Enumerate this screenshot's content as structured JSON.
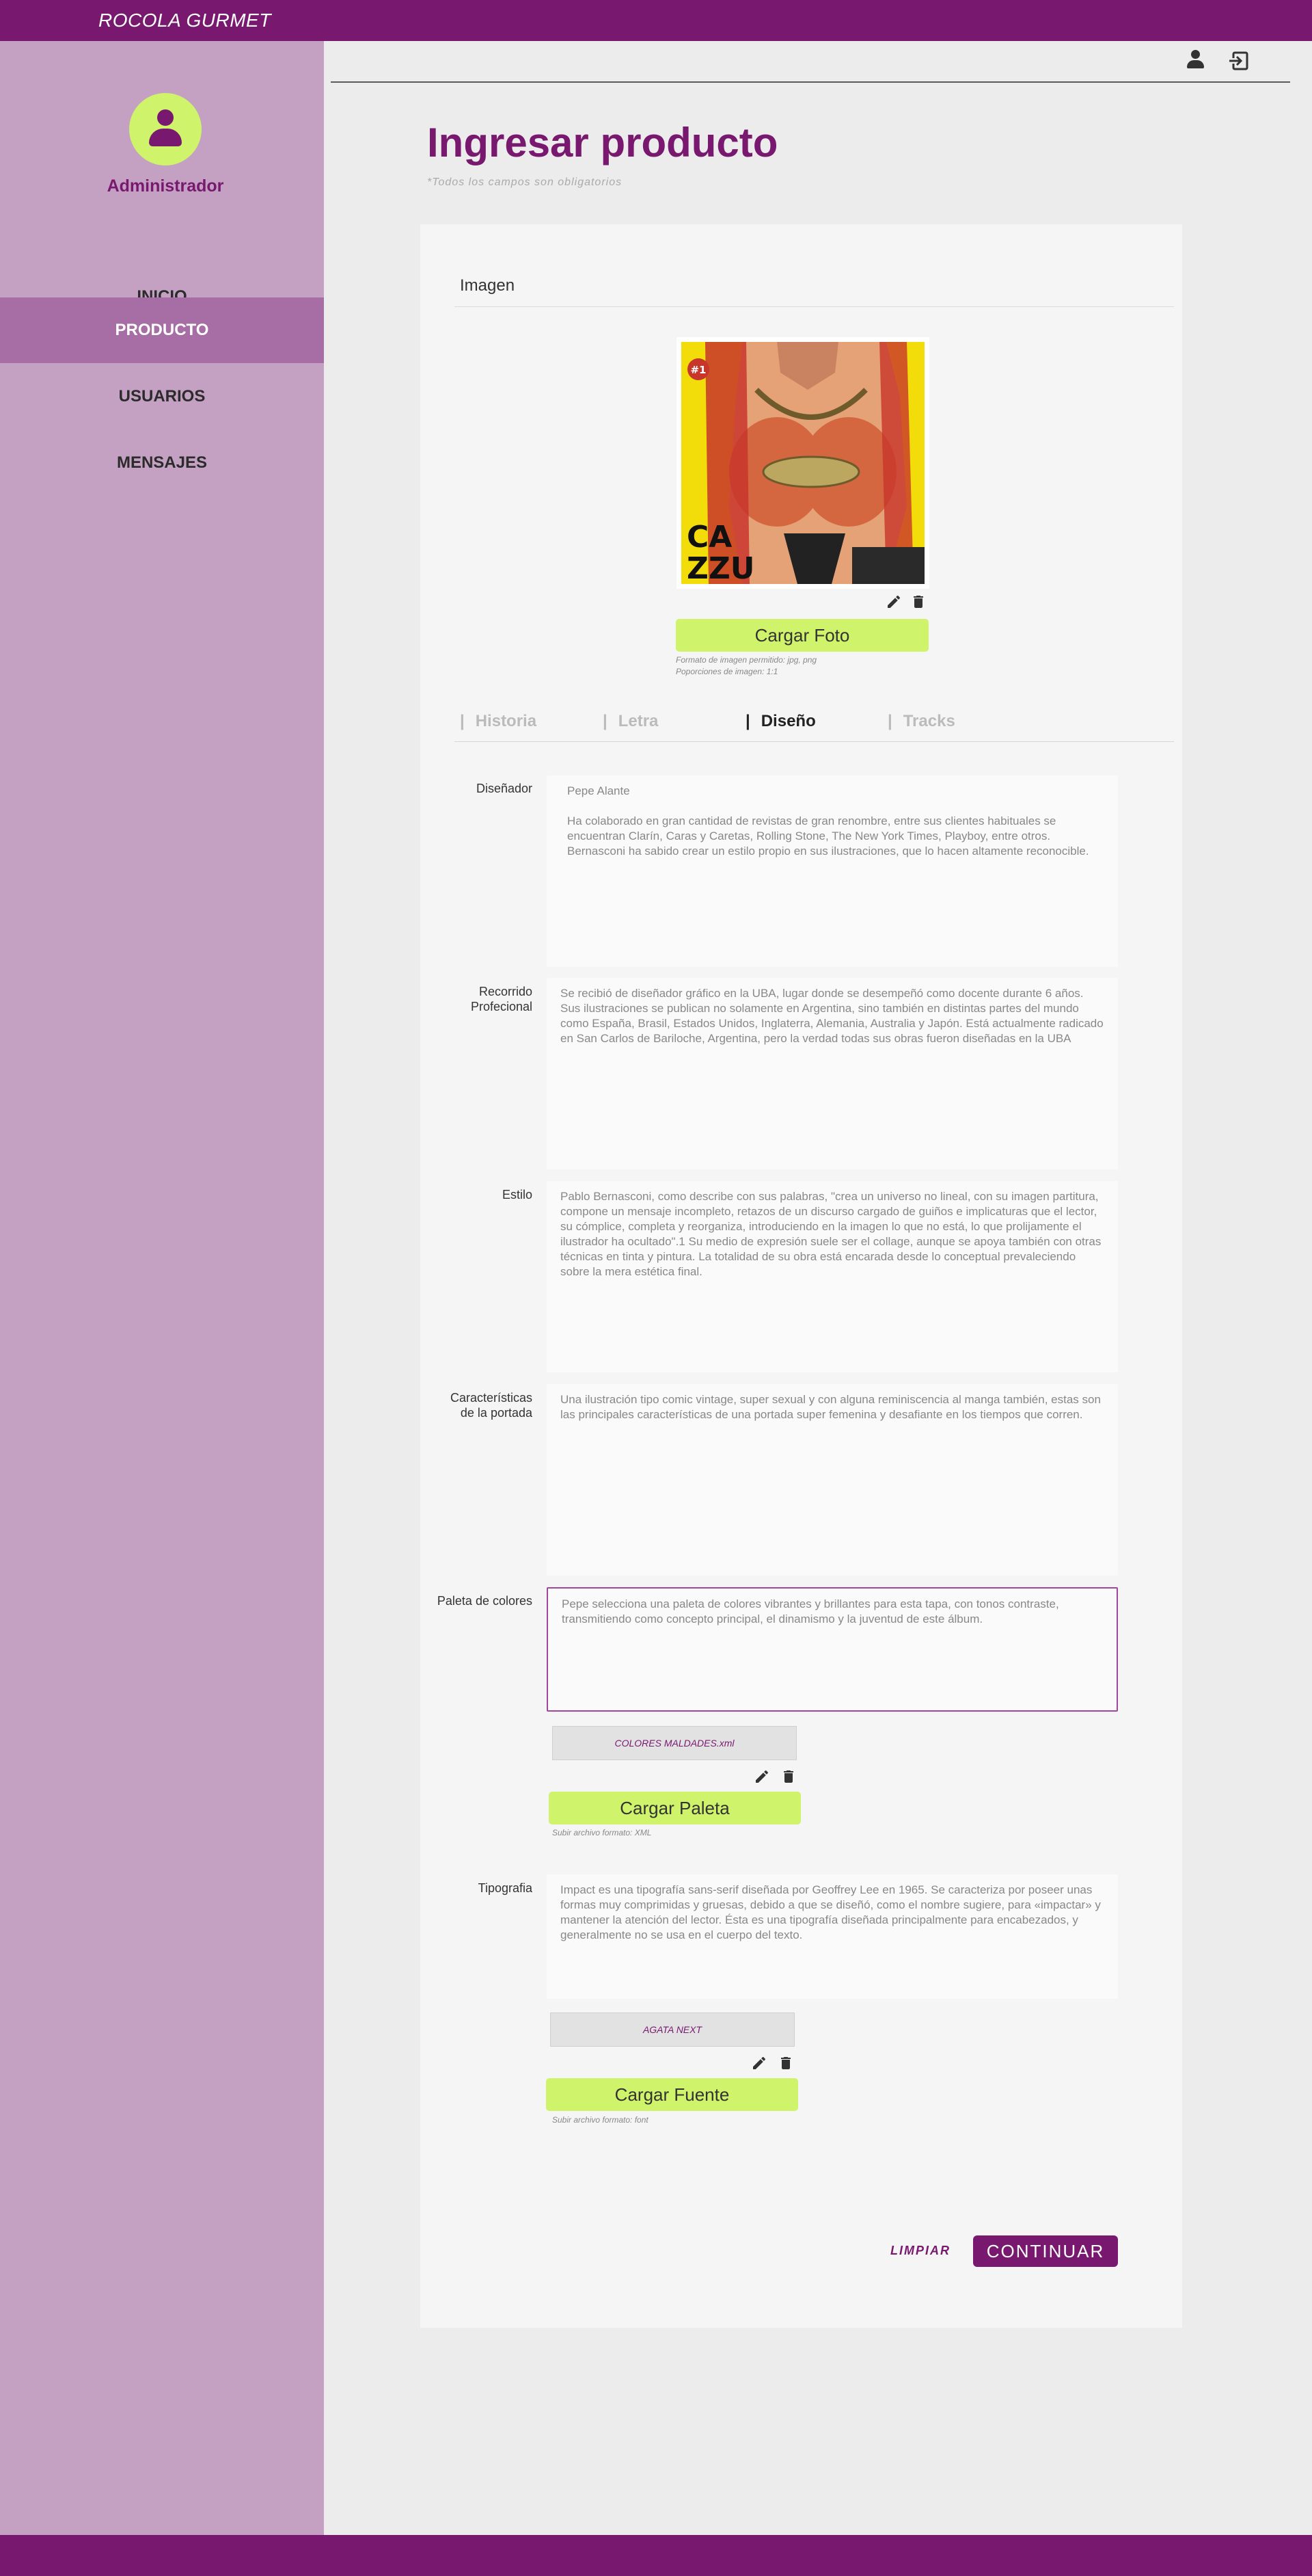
{
  "app": {
    "brand": "ROCOLA GURMET"
  },
  "sidebar": {
    "role": "Administrador",
    "items": [
      {
        "label": "INICIO",
        "active": false
      },
      {
        "label": "PRODUCTO",
        "active": true
      },
      {
        "label": "USUARIOS",
        "active": false
      },
      {
        "label": "MENSAJES",
        "active": false
      }
    ]
  },
  "header": {
    "icons": [
      "user-icon",
      "logout-icon"
    ]
  },
  "page": {
    "title": "Ingresar producto",
    "required_hint": "*Todos los campos son obligatorios"
  },
  "image_section": {
    "title": "Imagen",
    "cover_text": {
      "badge": "#1",
      "line1": "CA",
      "line2": "ZZU"
    },
    "upload_label": "Cargar Foto",
    "format_note": "Formato de imagen permitido: jpg, png",
    "ratio_note": "Poporciones de imagen: 1:1"
  },
  "tabs": [
    {
      "label": "Historia",
      "active": false
    },
    {
      "label": "Letra",
      "active": false
    },
    {
      "label": "Diseño",
      "active": true
    },
    {
      "label": "Tracks",
      "active": false
    }
  ],
  "fields": {
    "disenador": {
      "label": "Diseñador",
      "name": "Pepe Alante",
      "bio": "Ha colaborado en gran cantidad de revistas de gran renombre, entre sus clientes habituales se encuentran Clarín, Caras y Caretas, Rolling Stone, The New York Times, Playboy, entre otros. Bernasconi ha sabido crear un estilo propio en sus ilustraciones, que lo hacen altamente reconocible."
    },
    "recorrido": {
      "label_line1": "Recorrido",
      "label_line2": "Profecional",
      "value": "Se recibió de diseñador gráfico en la UBA, lugar donde se desempeñó como docente durante 6 años. Sus ilustraciones se publican no solamente en Argentina, sino también en distintas partes del mundo como España, Brasil, Estados Unidos, Inglaterra, Alemania, Australia y Japón. Está actualmente radicado en San Carlos de Bariloche, Argentina, pero la verdad todas sus obras fueron diseñadas en la UBA"
    },
    "estilo": {
      "label": "Estilo",
      "value": "Pablo Bernasconi, como describe con sus palabras, \"crea un universo no lineal, con su imagen partitura, compone un mensaje incompleto, retazos de un discurso cargado de guiños e implicaturas que el lector, su cómplice, completa y reorganiza, introduciendo en la imagen lo que no está, lo que prolijamente el ilustrador ha ocultado\".1 Su medio de expresión suele ser el collage, aunque se apoya también con otras técnicas en tinta y pintura. La totalidad de su obra está encarada desde lo conceptual prevaleciendo sobre la mera estética final."
    },
    "caracteristicas": {
      "label_line1": "Características",
      "label_line2": "de la portada",
      "value": "Una ilustración tipo comic vintage, super sexual y con alguna reminiscencia al manga también, estas son las principales características de una portada super femenina y desafiante en los tiempos que corren."
    },
    "paleta": {
      "label": "Paleta de colores",
      "value": "Pepe selecciona una paleta de colores vibrantes y brillantes para esta tapa, con tonos contraste, transmitiendo como concepto principal, el dinamismo y la juventud de este álbum.",
      "file_name": "COLORES MALDADES.xml",
      "upload_label": "Cargar Paleta",
      "format_note": "Subir archivo formato: XML"
    },
    "tipografia": {
      "label": "Tipografia",
      "value": "Impact es una tipografía sans-serif diseñada por Geoffrey Lee en 1965. Se caracteriza por poseer unas formas muy comprimidas y gruesas, debido a que se diseñó, como el nombre sugiere, para «impactar» y mantener la atención del lector. Ésta es una tipografía diseñada principalmente para encabezados, y generalmente no se usa en el cuerpo del texto.",
      "file_name": "AGATA NEXT",
      "upload_label": "Cargar Fuente",
      "format_note": "Subir archivo formato: font"
    }
  },
  "actions": {
    "clear": "LIMPIAR",
    "continue": "CONTINUAR"
  },
  "colors": {
    "primary": "#78196f",
    "accent": "#cff36a",
    "sidebar": "#c4a1c2",
    "sidebar_active": "#a66ea4"
  }
}
